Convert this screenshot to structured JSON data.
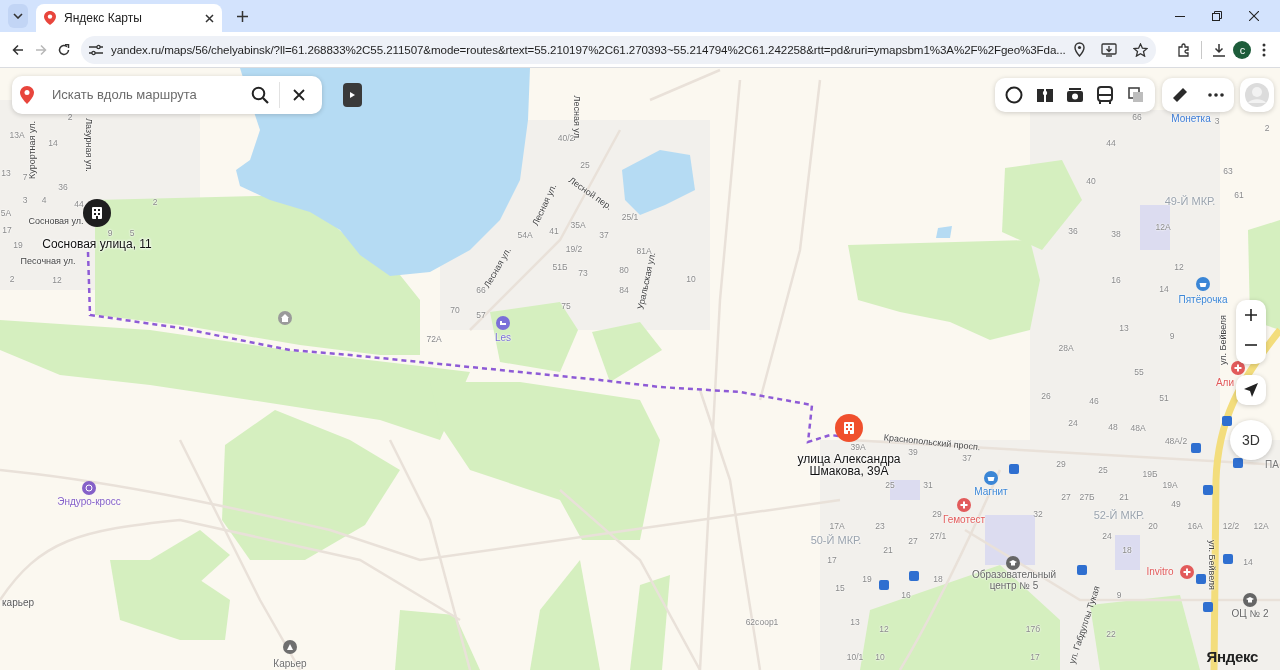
{
  "browser": {
    "tabs": [
      {
        "title": "Яндекс Карты",
        "selected": true
      }
    ],
    "nav": {
      "forward_disabled": true
    },
    "url": "yandex.ru/maps/56/chelyabinsk/?ll=61.268833%2C55.211507&mode=routes&rtext=55.210197%2C61.270393~55.214794%2C61.242258&rtt=pd&ruri=ymapsbm1%3A%2F%2Fgeo%3Fda...",
    "profile_initial": "c"
  },
  "map": {
    "search": {
      "placeholder": "Искать вдоль маршрута"
    },
    "three_d": "3D",
    "logo": "Яндекс",
    "pins": [
      {
        "label": "Сосновая улица, 11",
        "color": "#1e1e1e"
      },
      {
        "label": "улица Александра Шмакова, 39А",
        "color": "#f0502d"
      }
    ],
    "labels": [
      {
        "kind": "street",
        "text": "Курортная ул."
      },
      {
        "kind": "street",
        "text": "Лазурная ул."
      },
      {
        "kind": "street",
        "text": "Сосновая ул."
      },
      {
        "kind": "street",
        "text": "Песочная ул."
      },
      {
        "kind": "street",
        "text": "Лесная ул."
      },
      {
        "kind": "street",
        "text": "Лесная ул."
      },
      {
        "kind": "street",
        "text": "Лесной пер."
      },
      {
        "kind": "street",
        "text": "Лесная ул."
      },
      {
        "kind": "street",
        "text": "Уральская ул."
      },
      {
        "kind": "street",
        "text": "Краснопольский просп."
      },
      {
        "kind": "street",
        "text": "ул. Габдуллы Тукая"
      },
      {
        "kind": "street",
        "text": "ул. Бейвеля"
      },
      {
        "kind": "street",
        "text": "ул. Бейвеля"
      },
      {
        "kind": "district",
        "text": "49-Й МКР."
      },
      {
        "kind": "district",
        "text": "52-Й МКР."
      },
      {
        "kind": "district",
        "text": "50-Й МКР."
      },
      {
        "kind": "poi",
        "text": "Les",
        "color": "#7b6fd8"
      },
      {
        "kind": "poi",
        "text": "Эндуро-кросс",
        "color": "#8560c8"
      },
      {
        "kind": "poi",
        "text": "карьер",
        "color": "#5a5a5a"
      },
      {
        "kind": "poi",
        "text": "Карьер",
        "color": "#6f6f6f"
      },
      {
        "kind": "poi",
        "text": "Монетка",
        "color": "#3b7bd6"
      },
      {
        "kind": "poi",
        "text": "Пятёрочка",
        "color": "#3b86d6"
      },
      {
        "kind": "poi",
        "text": "Магнит",
        "color": "#3b86d6"
      },
      {
        "kind": "poi",
        "text": "Гемотест",
        "color": "#e25b5b"
      },
      {
        "kind": "poi",
        "text": "Образовательный центр № 5",
        "color": "#666666"
      },
      {
        "kind": "poi",
        "text": "Invitro",
        "color": "#e25b5b"
      },
      {
        "kind": "poi",
        "text": "ОЦ № 2",
        "color": "#666666"
      },
      {
        "kind": "poi",
        "text": "Али",
        "color": "#e25b5b"
      },
      {
        "kind": "poi",
        "text": "ПА",
        "color": "#777777"
      }
    ],
    "house_numbers": [
      "2",
      "13А",
      "14",
      "13",
      "7",
      "36",
      "3",
      "4",
      "44",
      "2",
      "5А",
      "17",
      "9",
      "5",
      "19",
      "2",
      "12",
      "40/2",
      "25",
      "25/1",
      "54А",
      "41",
      "35А",
      "37",
      "19/2",
      "81А",
      "51Б",
      "73",
      "80",
      "84",
      "10",
      "66",
      "70",
      "57",
      "75",
      "72А",
      "66",
      "3",
      "2",
      "44",
      "63",
      "40",
      "61",
      "36",
      "38",
      "12А",
      "12",
      "16",
      "14",
      "13",
      "9",
      "28А",
      "55",
      "26",
      "51",
      "46",
      "24",
      "48",
      "48А",
      "48А/2",
      "39А",
      "39",
      "37",
      "29",
      "25",
      "19Б",
      "25",
      "31",
      "19А",
      "27",
      "27Б",
      "21",
      "49",
      "29",
      "32",
      "17А",
      "23",
      "20",
      "16А",
      "12/2",
      "12А",
      "27/1",
      "24",
      "27",
      "21",
      "18",
      "17",
      "14",
      "19",
      "18",
      "15",
      "16",
      "9",
      "62соор1",
      "13",
      "12",
      "17б",
      "22",
      "10/1",
      "10",
      "17"
    ]
  }
}
